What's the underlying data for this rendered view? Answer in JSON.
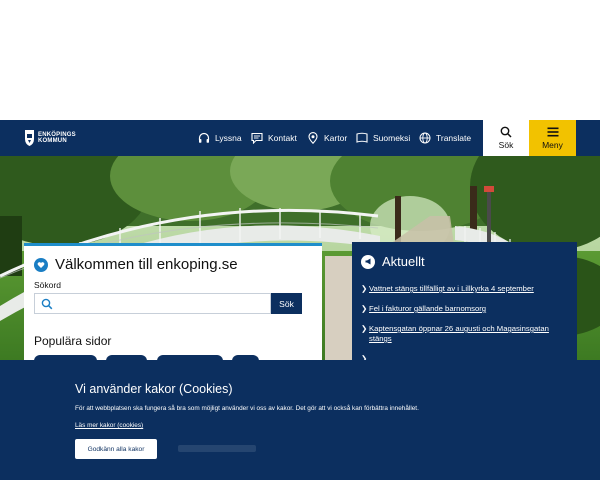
{
  "header": {
    "logo_line1": "ENKÖPINGS",
    "logo_line2": "KOMMUN",
    "nav": [
      {
        "label": "Lyssna",
        "icon": "headphones-icon"
      },
      {
        "label": "Kontakt",
        "icon": "chat-bubble-icon"
      },
      {
        "label": "Kartor",
        "icon": "map-pin-icon"
      },
      {
        "label": "Suomeksi",
        "icon": "flag-icon"
      },
      {
        "label": "Translate",
        "icon": "globe-icon"
      }
    ],
    "search_label": "Sök",
    "menu_label": "Meny"
  },
  "colors": {
    "brand_navy": "#0c2f5f",
    "accent_yellow": "#f2c200",
    "accent_blue": "#1f8ecb"
  },
  "welcome": {
    "title": "Välkommen till enkoping.se",
    "search_label": "Sökord",
    "search_value": "",
    "search_button": "Sök",
    "popular_title": "Populära sidor"
  },
  "news": {
    "title": "Aktuellt",
    "items": [
      "Vattnet stängs tillfälligt av i Lillkyrka 4 september",
      "Fel i fakturor gällande barnomsorg",
      "Kaptensgatan öppnar 26 augusti och Magasinsgatan stängs"
    ]
  },
  "cookie": {
    "title": "Vi använder kakor (Cookies)",
    "description": "För att webbplatsen ska fungera så bra som möjligt använder vi oss av kakor. Det gör att vi också kan förbättra innehållet.",
    "more_link": "Läs mer kakor (cookies)",
    "accept_button": "Godkänn alla kakor"
  }
}
